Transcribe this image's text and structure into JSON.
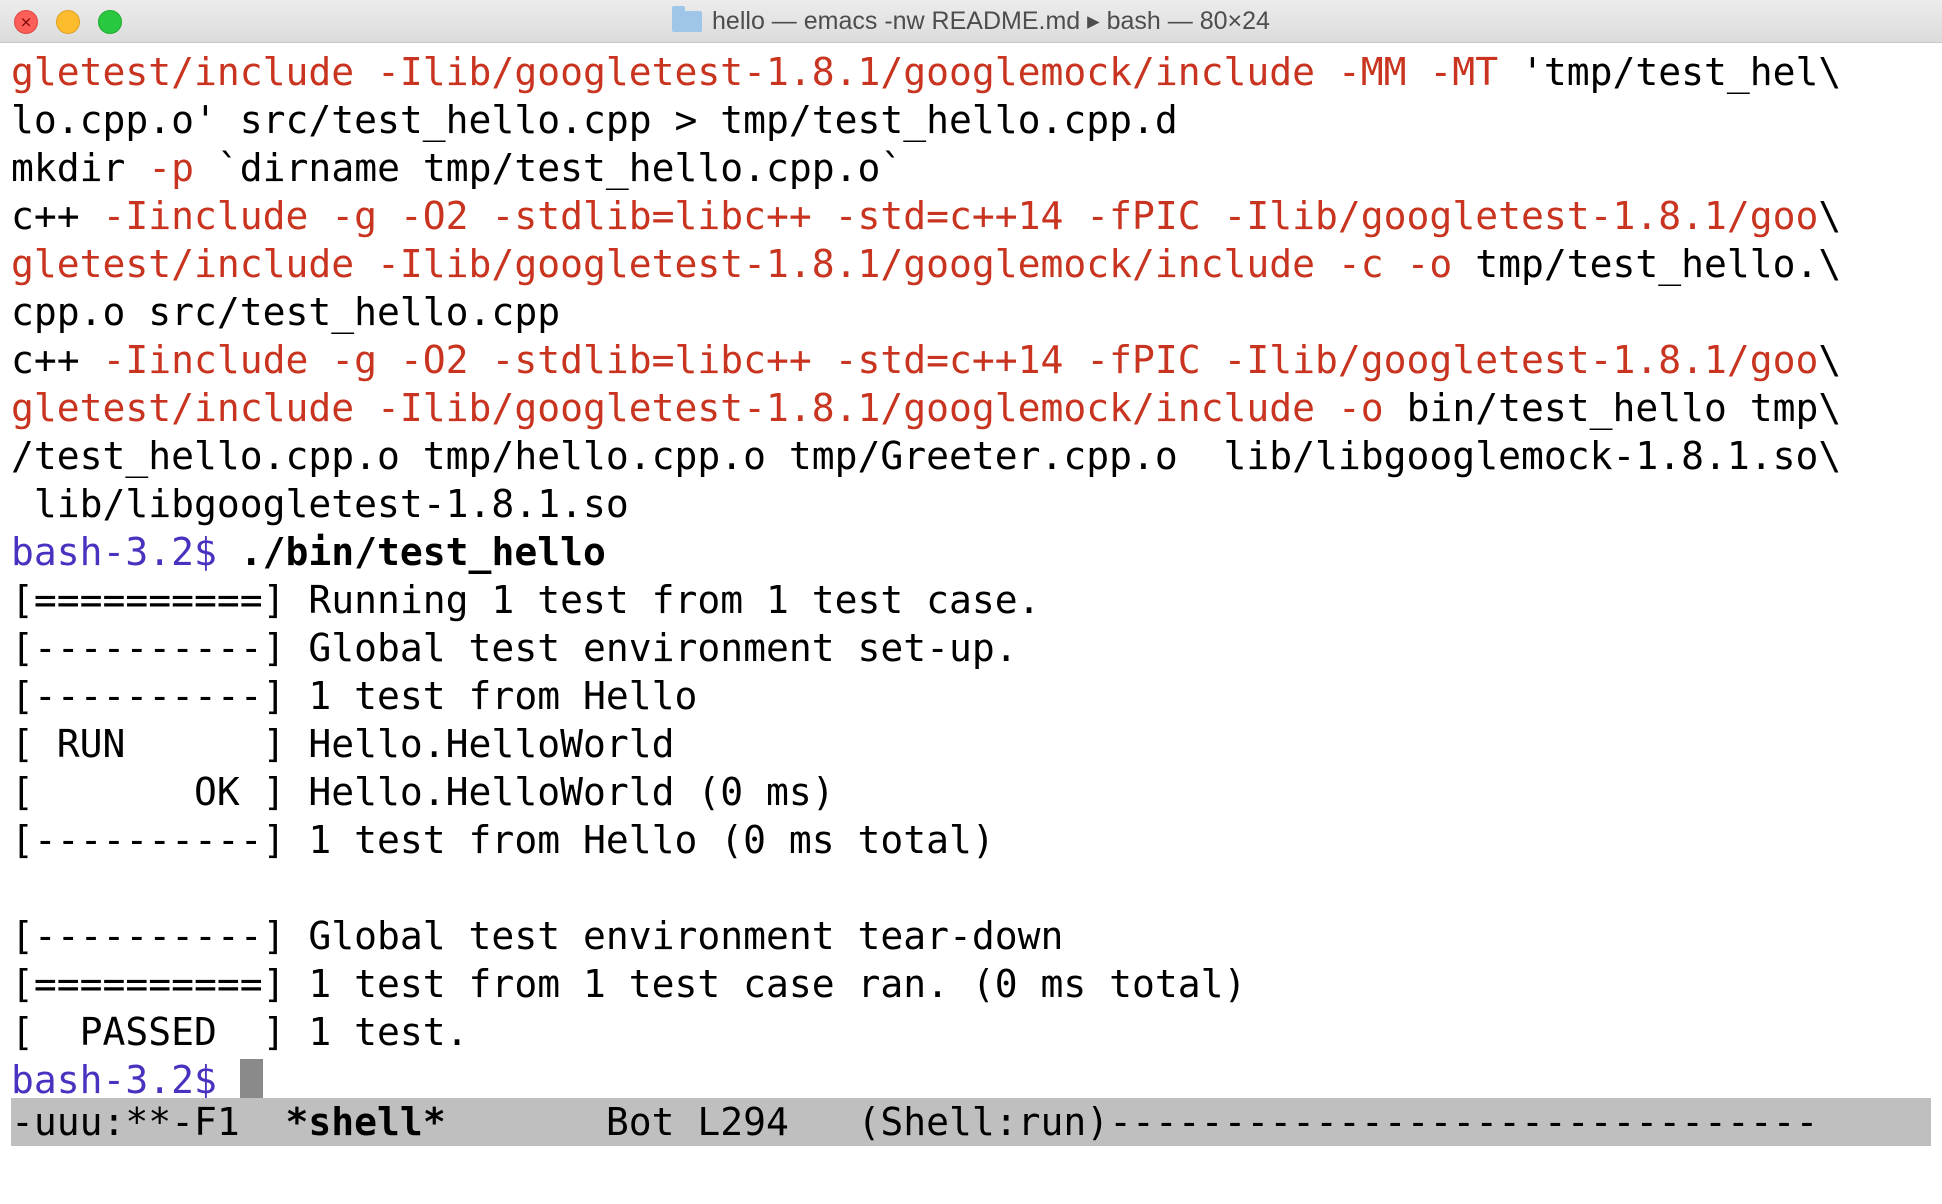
{
  "window": {
    "title": "hello — emacs -nw README.md ▸ bash — 80×24",
    "colors": {
      "error_red": "#c8341f",
      "prompt_purple": "#4833c1",
      "modeline_bg": "#bfbfbf"
    }
  },
  "terminal": {
    "lines": [
      {
        "kind": "text",
        "segments": [
          {
            "text": "gletest/include -Ilib/googletest-1.8.1/googlemock/include -MM -MT ",
            "style": "red"
          },
          {
            "text": "'tmp/test_hel\\",
            "style": "plain"
          }
        ]
      },
      {
        "kind": "text",
        "segments": [
          {
            "text": "lo.cpp.o' src/test_hello.cpp > tmp/test_hello.cpp.d",
            "style": "plain"
          }
        ]
      },
      {
        "kind": "text",
        "segments": [
          {
            "text": "mkdir ",
            "style": "plain"
          },
          {
            "text": "-p",
            "style": "red"
          },
          {
            "text": " `dirname tmp/test_hello.cpp.o`",
            "style": "plain"
          }
        ]
      },
      {
        "kind": "text",
        "segments": [
          {
            "text": "c++ ",
            "style": "plain"
          },
          {
            "text": "-Iinclude -g -O2 -stdlib=libc++ -std=c++14 -fPIC -Ilib/googletest-1.8.1/goo",
            "style": "red"
          },
          {
            "text": "\\",
            "style": "plain"
          }
        ]
      },
      {
        "kind": "text",
        "segments": [
          {
            "text": "gletest/include -Ilib/googletest-1.8.1/googlemock/include -c -o",
            "style": "red"
          },
          {
            "text": " tmp/test_hello.\\",
            "style": "plain"
          }
        ]
      },
      {
        "kind": "text",
        "segments": [
          {
            "text": "cpp.o src/test_hello.cpp",
            "style": "plain"
          }
        ]
      },
      {
        "kind": "text",
        "segments": [
          {
            "text": "c++ ",
            "style": "plain"
          },
          {
            "text": "-Iinclude -g -O2 -stdlib=libc++ -std=c++14 -fPIC -Ilib/googletest-1.8.1/goo",
            "style": "red"
          },
          {
            "text": "\\",
            "style": "plain"
          }
        ]
      },
      {
        "kind": "text",
        "segments": [
          {
            "text": "gletest/include -Ilib/googletest-1.8.1/googlemock/include -o",
            "style": "red"
          },
          {
            "text": " bin/test_hello tmp\\",
            "style": "plain"
          }
        ]
      },
      {
        "kind": "text",
        "segments": [
          {
            "text": "/test_hello.cpp.o tmp/hello.cpp.o tmp/Greeter.cpp.o  lib/libgooglemock-1.8.1.so\\",
            "style": "plain"
          }
        ]
      },
      {
        "kind": "text",
        "segments": [
          {
            "text": " lib/libgoogletest-1.8.1.so",
            "style": "plain"
          }
        ]
      },
      {
        "kind": "prompt",
        "segments": [
          {
            "text": "bash-3.2$ ",
            "style": "prompt"
          },
          {
            "text": "./bin/test_hello",
            "style": "bold"
          }
        ]
      },
      {
        "kind": "text",
        "segments": [
          {
            "text": "[==========] Running 1 test from 1 test case.",
            "style": "plain"
          }
        ]
      },
      {
        "kind": "text",
        "segments": [
          {
            "text": "[----------] Global test environment set-up.",
            "style": "plain"
          }
        ]
      },
      {
        "kind": "text",
        "segments": [
          {
            "text": "[----------] 1 test from Hello",
            "style": "plain"
          }
        ]
      },
      {
        "kind": "text",
        "segments": [
          {
            "text": "[ RUN      ] Hello.HelloWorld",
            "style": "plain"
          }
        ]
      },
      {
        "kind": "text",
        "segments": [
          {
            "text": "[       OK ] Hello.HelloWorld (0 ms)",
            "style": "plain"
          }
        ]
      },
      {
        "kind": "text",
        "segments": [
          {
            "text": "[----------] 1 test from Hello (0 ms total)",
            "style": "plain"
          }
        ]
      },
      {
        "kind": "text",
        "segments": [
          {
            "text": "",
            "style": "plain"
          }
        ]
      },
      {
        "kind": "text",
        "segments": [
          {
            "text": "[----------] Global test environment tear-down",
            "style": "plain"
          }
        ]
      },
      {
        "kind": "text",
        "segments": [
          {
            "text": "[==========] 1 test from 1 test case ran. (0 ms total)",
            "style": "plain"
          }
        ]
      },
      {
        "kind": "text",
        "segments": [
          {
            "text": "[  PASSED  ] 1 test.",
            "style": "plain"
          }
        ]
      },
      {
        "kind": "prompt-cursor",
        "segments": [
          {
            "text": "bash-3.2$ ",
            "style": "prompt"
          }
        ]
      }
    ]
  },
  "modeline": {
    "status": "-uuu:**-F1  ",
    "buffer": "*shell*",
    "position": "       Bot L294   (Shell:run)-------------------------------"
  }
}
